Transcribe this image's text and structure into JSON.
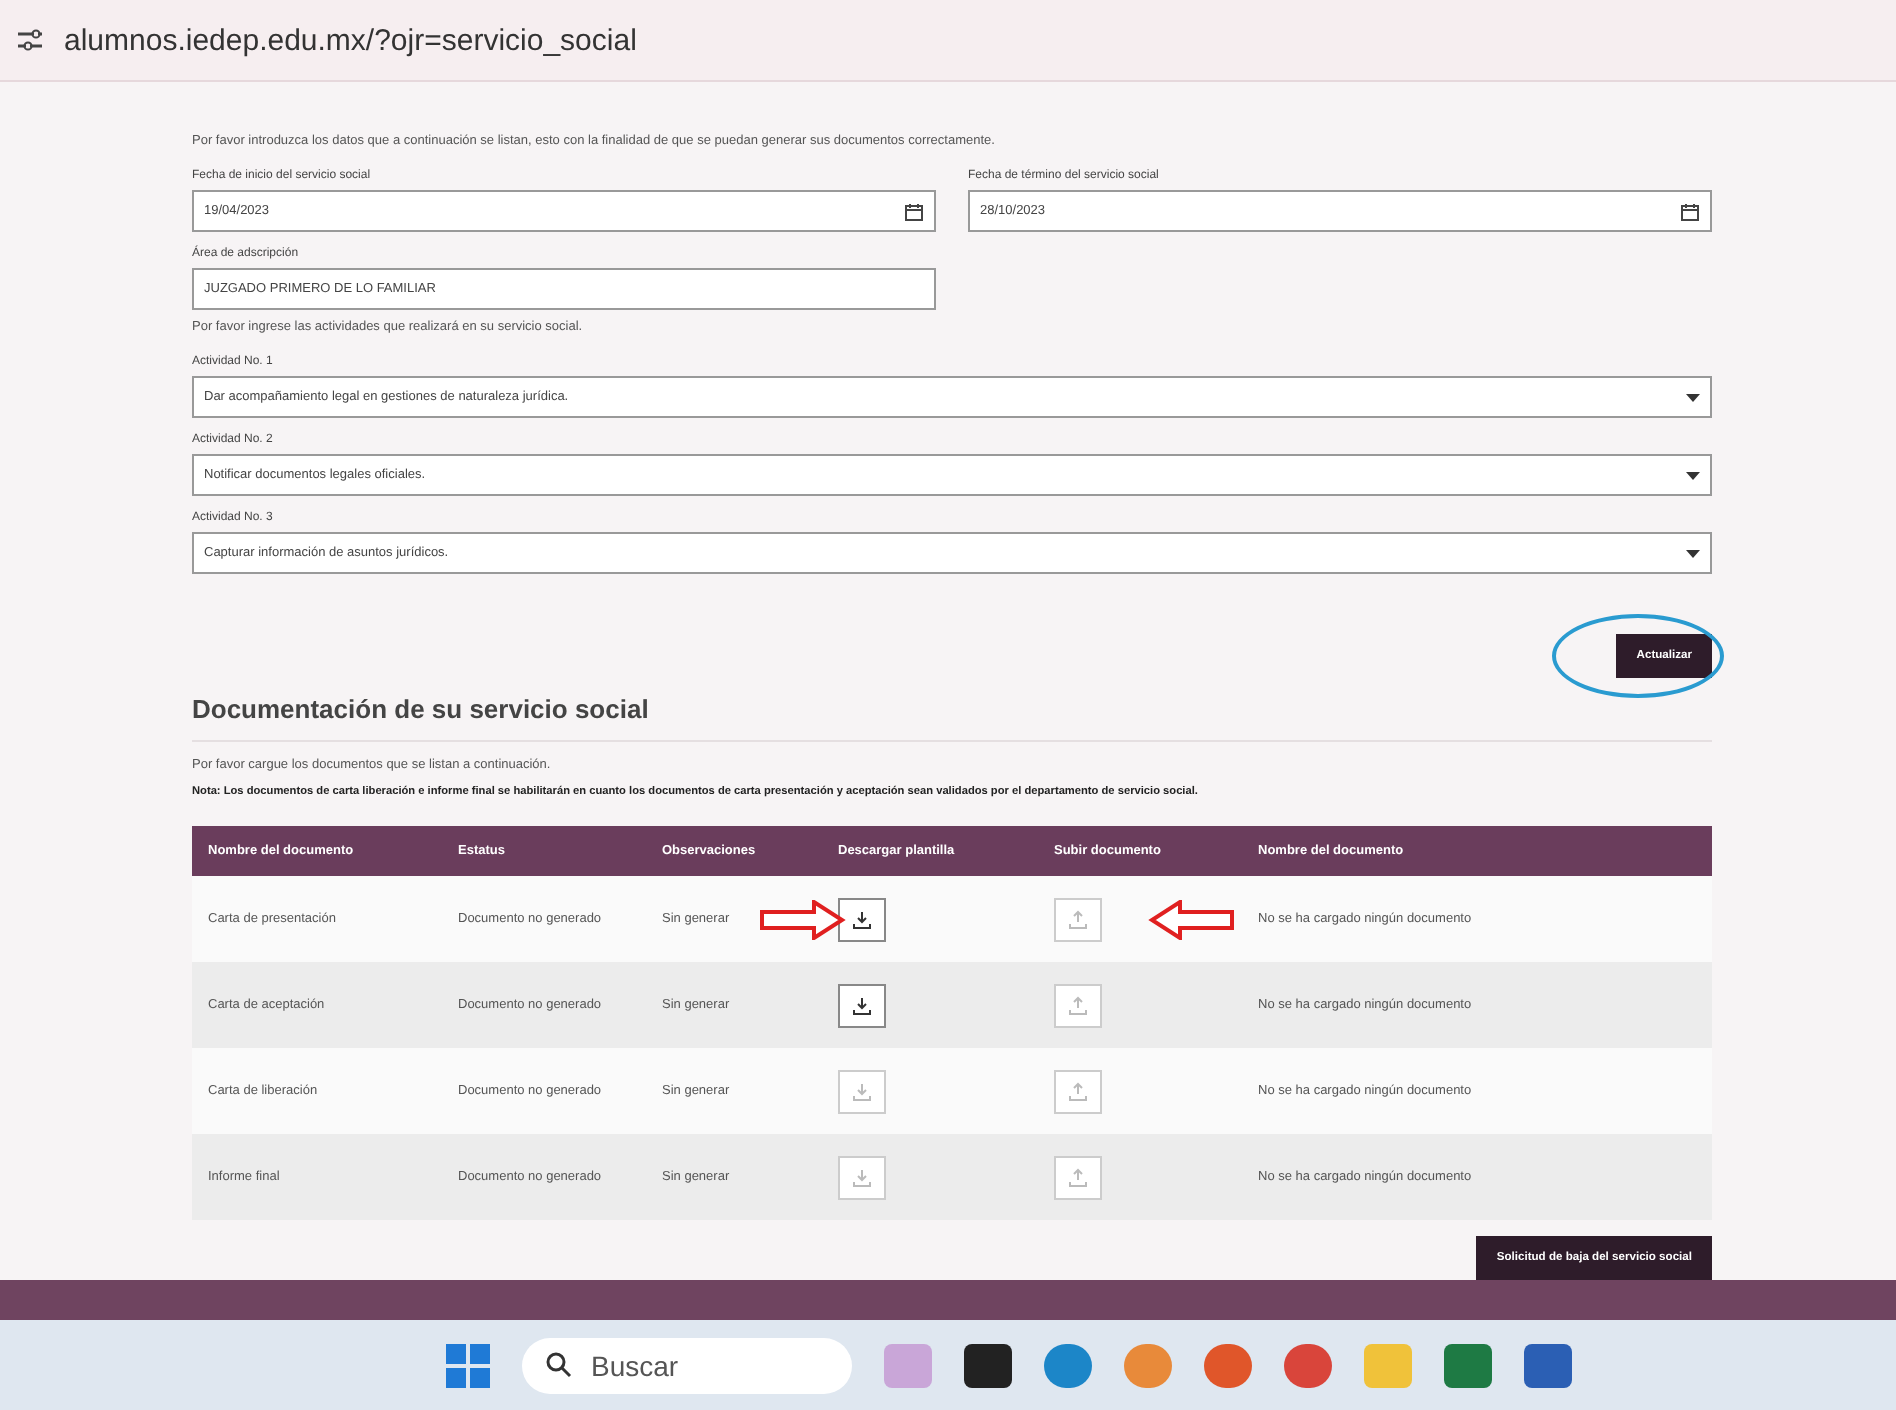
{
  "address_bar": {
    "url": "alumnos.iedep.edu.mx/?ojr=servicio_social"
  },
  "form": {
    "intro": "Por favor introduzca los datos que a continuación se listan, esto con la finalidad de que se puedan generar sus documentos correctamente.",
    "start_date": {
      "label": "Fecha de inicio del servicio social",
      "value": "19/04/2023"
    },
    "end_date": {
      "label": "Fecha de término del servicio social",
      "value": "28/10/2023"
    },
    "area": {
      "label": "Área de adscripción",
      "value": "JUZGADO PRIMERO DE LO FAMILIAR"
    },
    "activities_intro": "Por favor ingrese las actividades que realizará en su servicio social.",
    "activities": [
      {
        "label": "Actividad No. 1",
        "value": "Dar acompañamiento legal en gestiones de naturaleza jurídica."
      },
      {
        "label": "Actividad No. 2",
        "value": "Notificar documentos legales oficiales."
      },
      {
        "label": "Actividad No. 3",
        "value": "Capturar información de asuntos jurídicos."
      }
    ],
    "update_button": "Actualizar"
  },
  "documents": {
    "title": "Documentación de su servicio social",
    "intro": "Por favor cargue los documentos que se listan a continuación.",
    "note": "Nota: Los documentos de carta liberación e informe final se habilitarán en cuanto los documentos de carta presentación y aceptación sean validados por el departamento de servicio social.",
    "columns": [
      "Nombre del documento",
      "Estatus",
      "Observaciones",
      "Descargar plantilla",
      "Subir documento",
      "Nombre del documento"
    ],
    "rows": [
      {
        "name": "Carta de presentación",
        "status": "Documento no generado",
        "observations": "Sin generar",
        "download_enabled": true,
        "upload_enabled": false,
        "file": "No se ha cargado ningún documento"
      },
      {
        "name": "Carta de aceptación",
        "status": "Documento no generado",
        "observations": "Sin generar",
        "download_enabled": true,
        "upload_enabled": false,
        "file": "No se ha cargado ningún documento"
      },
      {
        "name": "Carta de liberación",
        "status": "Documento no generado",
        "observations": "Sin generar",
        "download_enabled": false,
        "upload_enabled": false,
        "file": "No se ha cargado ningún documento"
      },
      {
        "name": "Informe final",
        "status": "Documento no generado",
        "observations": "Sin generar",
        "download_enabled": false,
        "upload_enabled": false,
        "file": "No se ha cargado ningún documento"
      }
    ],
    "request_button": "Solicitud de baja del servicio social"
  },
  "taskbar": {
    "search_placeholder": "Buscar"
  }
}
